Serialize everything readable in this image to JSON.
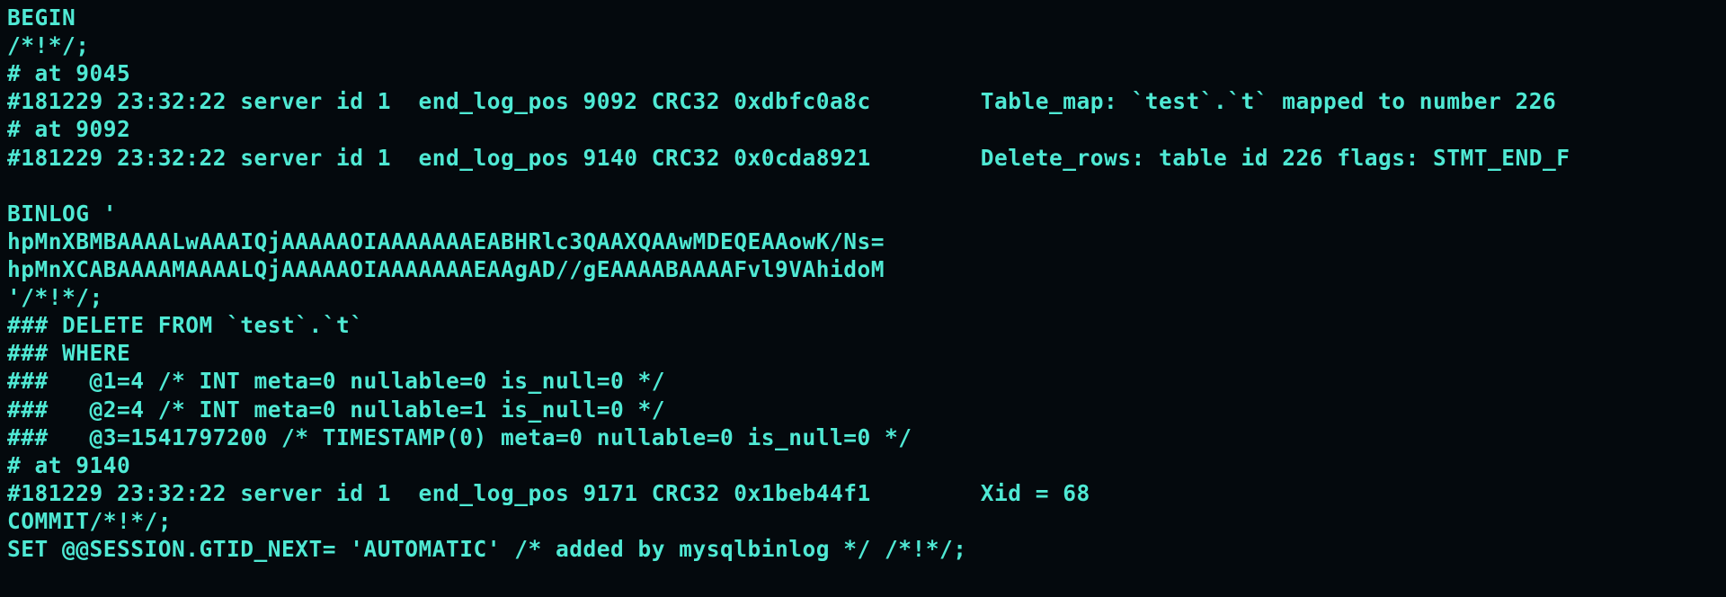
{
  "terminal": {
    "lines": [
      "BEGIN",
      "/*!*/;",
      "# at 9045",
      "#181229 23:32:22 server id 1  end_log_pos 9092 CRC32 0xdbfc0a8c        Table_map: `test`.`t` mapped to number 226",
      "# at 9092",
      "#181229 23:32:22 server id 1  end_log_pos 9140 CRC32 0x0cda8921        Delete_rows: table id 226 flags: STMT_END_F",
      "",
      "BINLOG '",
      "hpMnXBMBAAAALwAAAIQjAAAAAOIAAAAAAAEABHRlc3QAAXQAAwMDEQEAAowK/Ns=",
      "hpMnXCABAAAAMAAAALQjAAAAAOIAAAAAAAEAAgAD//gEAAAABAAAAFvl9VAhidoM",
      "'/*!*/;",
      "### DELETE FROM `test`.`t`",
      "### WHERE",
      "###   @1=4 /* INT meta=0 nullable=0 is_null=0 */",
      "###   @2=4 /* INT meta=0 nullable=1 is_null=0 */",
      "###   @3=1541797200 /* TIMESTAMP(0) meta=0 nullable=0 is_null=0 */",
      "# at 9140",
      "#181229 23:32:22 server id 1  end_log_pos 9171 CRC32 0x1beb44f1        Xid = 68",
      "COMMIT/*!*/;",
      "SET @@SESSION.GTID_NEXT= 'AUTOMATIC' /* added by mysqlbinlog */ /*!*/;"
    ]
  }
}
